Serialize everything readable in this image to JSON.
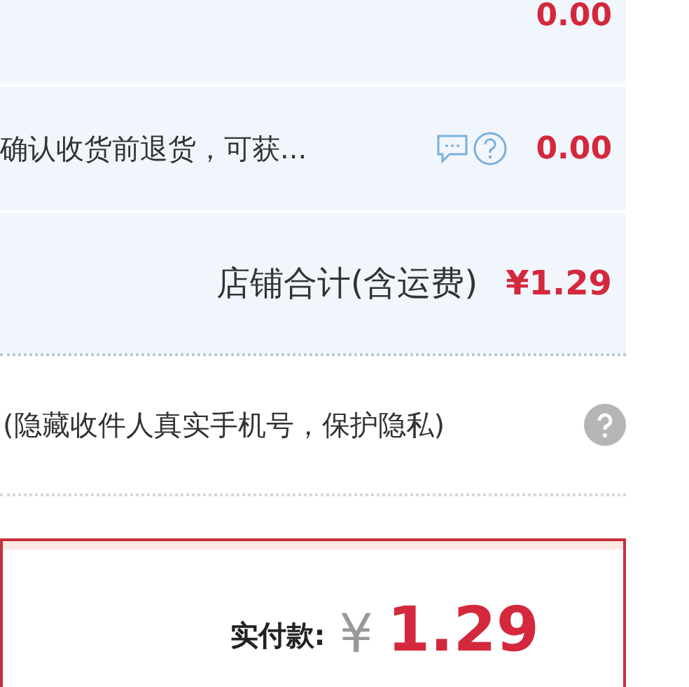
{
  "top_row": {
    "amount": "0.00"
  },
  "refund_row": {
    "text": "确认收货前退货，可获...",
    "amount": "0.00"
  },
  "shop_total": {
    "label": "店铺合计(含运费)",
    "amount": "¥1.29"
  },
  "privacy_row": {
    "text": "(隐藏收件人真实手机号，保护隐私)"
  },
  "payment": {
    "label": "实付款:",
    "currency": "¥",
    "amount": "1.29"
  }
}
